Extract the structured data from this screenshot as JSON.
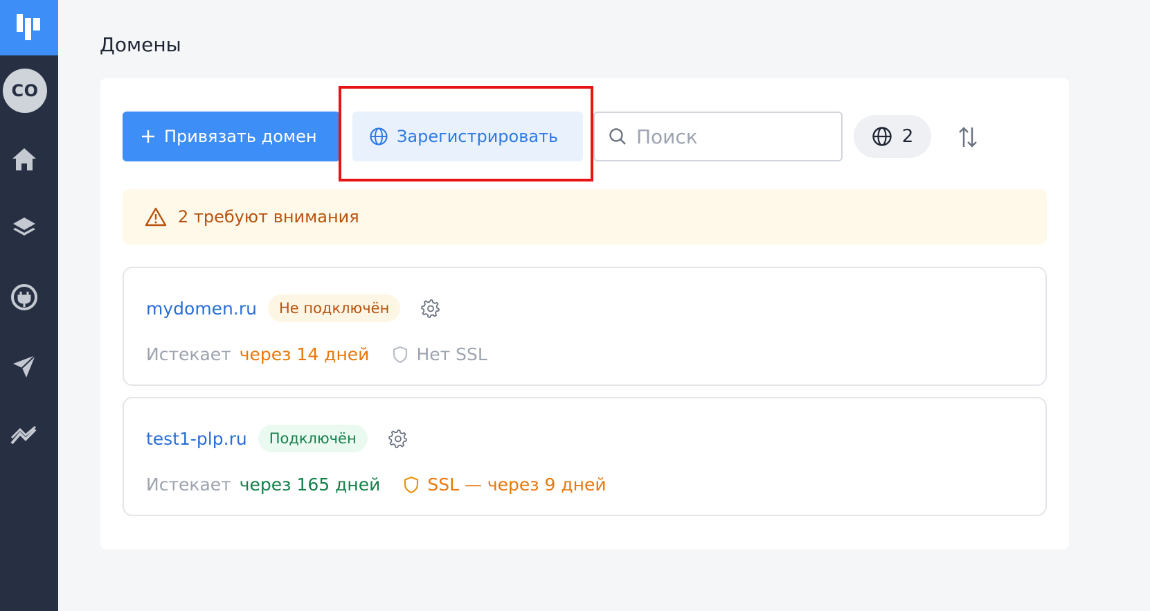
{
  "page": {
    "title": "Домены"
  },
  "sidebar": {
    "avatar_initials": "CO",
    "items": [
      {
        "icon": "home-icon"
      },
      {
        "icon": "layers-icon"
      },
      {
        "icon": "plug-icon"
      },
      {
        "icon": "send-icon"
      },
      {
        "icon": "analytics-icon"
      }
    ]
  },
  "toolbar": {
    "attach_label": "Привязать домен",
    "register_label": "Зарегистрировать",
    "search_placeholder": "Поиск",
    "domain_count": "2"
  },
  "alert": {
    "text": "2 требуют внимания"
  },
  "domains": [
    {
      "name": "mydomen.ru",
      "status": "Не подключён",
      "expires_label": "Истекает",
      "expires_value": "через 14 дней",
      "ssl_text": "Нет SSL"
    },
    {
      "name": "test1-plp.ru",
      "status": "Подключён",
      "expires_label": "Истекает",
      "expires_value": "через 165 дней",
      "ssl_text": "SSL — через 9 дней"
    }
  ],
  "colors": {
    "primary": "#3e8ef7",
    "sidebar": "#272f43",
    "warning": "#e8780c",
    "success": "#14804a",
    "highlight": "#e81414"
  }
}
